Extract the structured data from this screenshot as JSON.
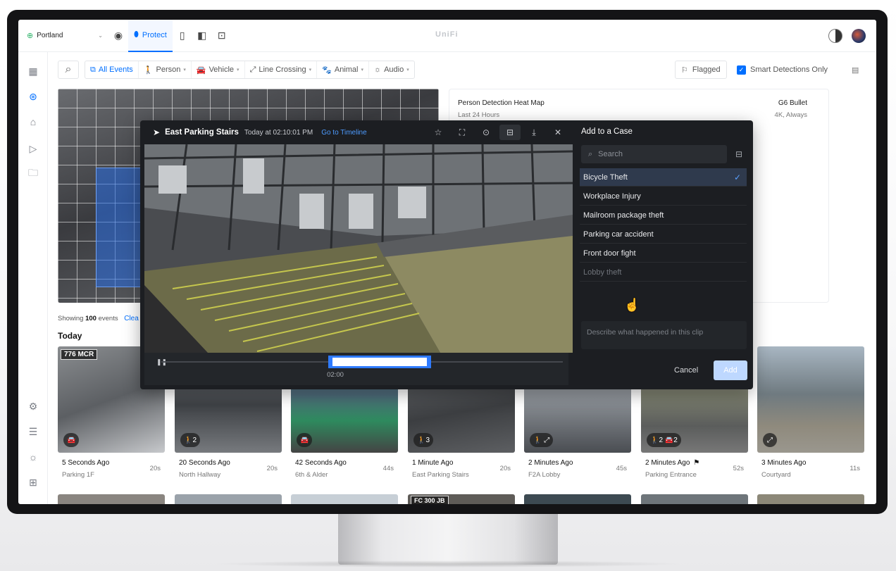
{
  "topbar": {
    "site": "Portland",
    "app_name": "Protect",
    "brand": "UniFi"
  },
  "filters": {
    "all_events": "All Events",
    "person": "Person",
    "vehicle": "Vehicle",
    "line_crossing": "Line Crossing",
    "animal": "Animal",
    "audio": "Audio",
    "flagged": "Flagged",
    "smart_only": "Smart Detections Only"
  },
  "heatmap": {
    "title": "Person Detection Heat Map",
    "period": "Last 24 Hours",
    "camera": "G6 Bullet",
    "mode": "4K, Always"
  },
  "list": {
    "showing_prefix": "Showing",
    "count": "100",
    "showing_suffix": "events",
    "clear": "Clea",
    "today": "Today"
  },
  "events": [
    {
      "time": "5 Seconds Ago",
      "location": "Parking 1F",
      "duration": "20s",
      "plate": "776 MCR",
      "badge": "🚘"
    },
    {
      "time": "20 Seconds Ago",
      "location": "North Hallway",
      "duration": "20s",
      "badge": "🚶2"
    },
    {
      "time": "42 Seconds Ago",
      "location": "6th & Alder",
      "duration": "44s",
      "badge": "🚘"
    },
    {
      "time": "1 Minute Ago",
      "location": "East Parking Stairs",
      "duration": "20s",
      "badge": "🚶3"
    },
    {
      "time": "2 Minutes Ago",
      "location": "F2A Lobby",
      "duration": "45s",
      "badge": "🚶 ⤢"
    },
    {
      "time": "2 Minutes Ago",
      "location": "Parking Entrance",
      "duration": "52s",
      "badge": "🚶2 🚘2",
      "flag": "⚑"
    },
    {
      "time": "3 Minutes Ago",
      "location": "Courtyard",
      "duration": "11s",
      "badge": "⤢"
    }
  ],
  "row2_plate": "FC 300 JB",
  "modal": {
    "camera": "East Parking Stairs",
    "timestamp": "Today at 02:10:01 PM",
    "go_timeline": "Go to Timeline",
    "scrub_time": "02:00",
    "panel_title": "Add to a Case",
    "search_placeholder": "Search",
    "cases": [
      "Bicycle Theft",
      "Workplace Injury",
      "Mailroom package theft",
      "Parking car accident",
      "Front door fight",
      "Lobby theft"
    ],
    "selected_case": "Bicycle Theft",
    "desc_placeholder": "Describe what happened in this clip",
    "cancel": "Cancel",
    "add": "Add"
  },
  "colors": {
    "accent": "#006fff",
    "modal_bg": "#1c1e22",
    "selection": "#2f7bff"
  }
}
